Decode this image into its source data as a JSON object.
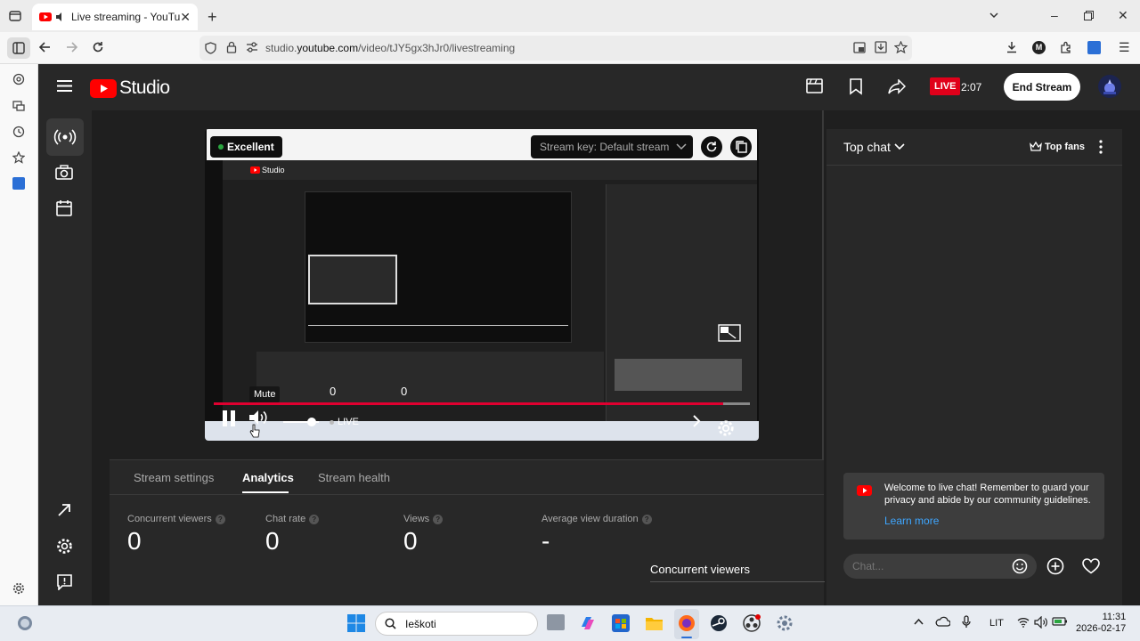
{
  "browser": {
    "tab_title": "Live streaming - YouTube S",
    "url_prefix": "studio.",
    "url_domain": "youtube.com",
    "url_path": "/video/tJY5gx3hJr0/livestreaming"
  },
  "header": {
    "logo": "Studio",
    "live_badge": "LIVE",
    "live_time": "2:07",
    "end_stream": "End Stream"
  },
  "preview": {
    "quality": "Excellent",
    "stream_key": "Stream key: Default stream",
    "mute_tooltip": "Mute",
    "live_label": "LIVE",
    "volume_level": 0.8
  },
  "tabs": [
    {
      "label": "Stream settings",
      "active": false
    },
    {
      "label": "Analytics",
      "active": true
    },
    {
      "label": "Stream health",
      "active": false
    }
  ],
  "stats": [
    {
      "label": "Concurrent viewers",
      "value": "0"
    },
    {
      "label": "Chat rate",
      "value": "0"
    },
    {
      "label": "Views",
      "value": "0"
    },
    {
      "label": "Average view duration",
      "value": "-"
    }
  ],
  "metric_dropdown": "Concurrent viewers",
  "chat": {
    "title": "Top chat",
    "top_fans": "Top fans",
    "welcome": "Welcome to live chat! Remember to guard your privacy and abide by our community guidelines.",
    "learn_more": "Learn more",
    "placeholder": "Chat..."
  },
  "taskbar": {
    "search": "Ieškoti",
    "lang": "LIT",
    "time": "11:31",
    "date": "2026-02-17"
  },
  "colors": {
    "accent_red": "#e00030",
    "link_blue": "#3ea6ff",
    "status_green": "#2ba640"
  }
}
